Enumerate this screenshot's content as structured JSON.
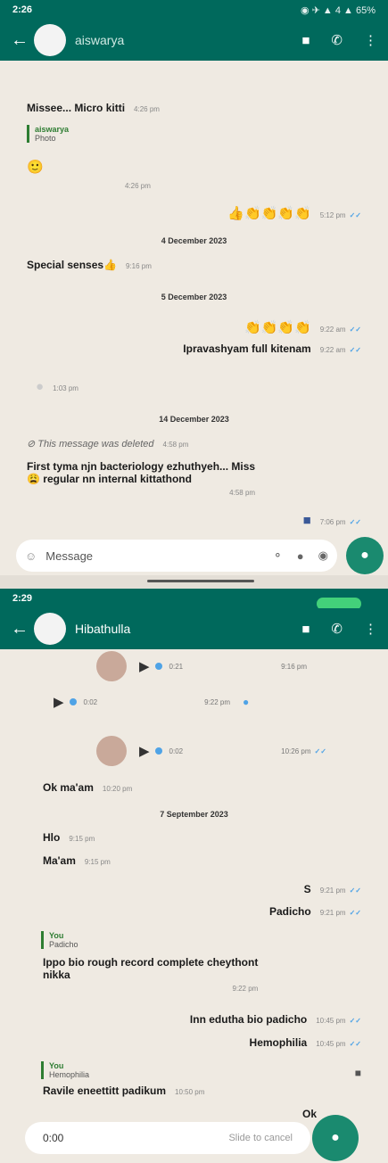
{
  "screen1": {
    "status_time": "2:26",
    "status_right": "◉ ✈ ▲ 4 ▲ 65%",
    "contact": "aiswarya",
    "messages": {
      "m1": {
        "text": "Missee... Micro kitti",
        "time": "4:26 pm"
      },
      "quote1": {
        "name": "aiswarya",
        "text": "Photo"
      },
      "m2": {
        "emoji": "🙂",
        "time": "4:26 pm"
      },
      "m3": {
        "emoji": "👍👏👏👏👏",
        "time": "5:12 pm"
      },
      "date1": "4 December 2023",
      "m4": {
        "text": "Special senses👍",
        "time": "9:16 pm"
      },
      "date2": "5 December 2023",
      "m5": {
        "emoji": "👏👏👏👏",
        "time": "9:22 am"
      },
      "m6": {
        "text": "Ipravashyam full kitenam",
        "time": "9:22 am"
      },
      "m7": {
        "time": "1:03 pm"
      },
      "date3": "14 December 2023",
      "m8": {
        "text": "This message was deleted",
        "time": "4:58 pm"
      },
      "m9": {
        "line1": "First tyma njn bacteriology ezhuthyeh... Miss",
        "line2": "😩 regular nn internal kittathond",
        "time": "4:58 pm"
      },
      "m10": {
        "time": "7:06 pm"
      }
    },
    "input_placeholder": "Message"
  },
  "screen2": {
    "status_time": "2:29",
    "contact": "Hibathulla",
    "voices": {
      "v1": {
        "duration": "0:21",
        "time": "9:16 pm"
      },
      "v2": {
        "duration": "0:02",
        "time": "9:22 pm"
      },
      "v3": {
        "duration": "0:02",
        "time": "10:26 pm"
      }
    },
    "messages": {
      "m1": {
        "text": "Ok ma'am",
        "time": "10:20 pm"
      },
      "date1": "7 September 2023",
      "m2": {
        "text": "Hlo",
        "time": "9:15 pm"
      },
      "m3": {
        "text": "Ma'am",
        "time": "9:15 pm"
      },
      "m4": {
        "text": "S",
        "time": "9:21 pm"
      },
      "m5": {
        "text": "Padicho",
        "time": "9:21 pm"
      },
      "quote1": {
        "name": "You",
        "text": "Padicho"
      },
      "m6": {
        "line1": "Ippo bio rough record complete cheythont",
        "line2": "nikka",
        "time": "9:22 pm"
      },
      "m7": {
        "text": "Inn edutha bio padicho",
        "time": "10:45 pm"
      },
      "m8": {
        "text": "Hemophilia",
        "time": "10:45 pm"
      },
      "quote2": {
        "name": "You",
        "text": "Hemophilia"
      },
      "m9": {
        "text": "Ravile eneettitt padikum",
        "time": "10:50 pm"
      },
      "m10": {
        "text": "Ok"
      }
    },
    "recording": {
      "duration": "0:00",
      "hint": "Slide to cancel"
    }
  }
}
